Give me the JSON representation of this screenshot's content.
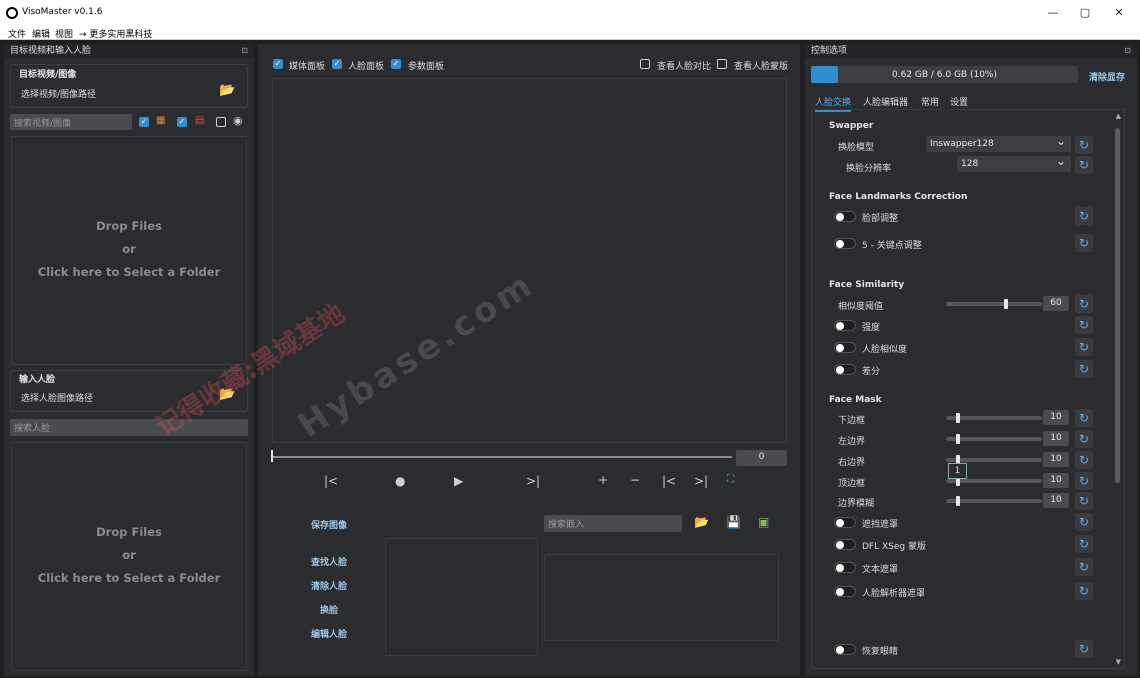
{
  "window": {
    "title": "VisoMaster v0.1.6",
    "min": "—",
    "max": "▢",
    "close": "✕"
  },
  "menu": [
    "文件",
    "编辑",
    "视图",
    "→ 更多实用黑科技"
  ],
  "left": {
    "dock_title": "目标视频和输入人脸",
    "target_group_title": "目标视频/图像",
    "target_path_label": "选择视频/图像路径",
    "search_target_placeholder": "搜索视频/图像",
    "dropzone1": {
      "line1": "Drop Files",
      "line2": "or",
      "line3": "Click here to Select a Folder"
    },
    "input_group_title": "输入人脸",
    "input_path_label": "选择人脸图像路径",
    "search_face_placeholder": "搜索人脸",
    "dropzone2": {
      "line1": "Drop Files",
      "line2": "or",
      "line3": "Click here to Select a Folder"
    }
  },
  "center": {
    "panels": [
      "媒体面板",
      "人脸面板",
      "参数面板"
    ],
    "compare_label": "查看人脸对比",
    "mask_label": "查看人脸蒙版",
    "frame_value": "0",
    "save_image": "保存图像",
    "search_embed_placeholder": "搜索嵌入",
    "actions": [
      "查找人脸",
      "清除人脸",
      "换脸",
      "编辑人脸"
    ]
  },
  "right": {
    "dock_title": "控制选项",
    "vram_text": "0.62 GB / 6.0 GB (10%)",
    "vram_fraction": 0.1,
    "clear_vram": "清除显存",
    "tabs": [
      "人脸交换",
      "人脸编辑器",
      "常用",
      "设置"
    ],
    "swapper": {
      "title": "Swapper",
      "model_label": "换脸模型",
      "model_value": "Inswapper128",
      "res_label": "换脸分辨率",
      "res_value": "128"
    },
    "landmarks": {
      "title": "Face Landmarks Correction",
      "items": [
        "脸部调整",
        "5 - 关键点调整"
      ]
    },
    "similarity": {
      "title": "Face Similarity",
      "threshold_label": "相似度阈值",
      "threshold_value": "60",
      "threshold_fraction": 0.6,
      "toggles": [
        "强度",
        "人脸相似度",
        "差分"
      ]
    },
    "mask": {
      "title": "Face Mask",
      "sliders": [
        {
          "label": "下边框",
          "value": "10"
        },
        {
          "label": "左边界",
          "value": "10"
        },
        {
          "label": "右边界",
          "value": "10"
        },
        {
          "label": "顶边框",
          "value": "10"
        },
        {
          "label": "边界模糊",
          "value": "10"
        }
      ],
      "tooltip": "1",
      "toggles": [
        "遮挡遮罩",
        "DFL XSeg 蒙版",
        "文本遮罩",
        "人脸解析器遮罩"
      ]
    },
    "restore_eyes": "恢复眼睛"
  },
  "watermark": {
    "line1": "记得收藏:黑域基地",
    "line2": "Hybase.com"
  },
  "colors": {
    "accent": "#2f8fd1",
    "link": "#9cc8e8"
  }
}
